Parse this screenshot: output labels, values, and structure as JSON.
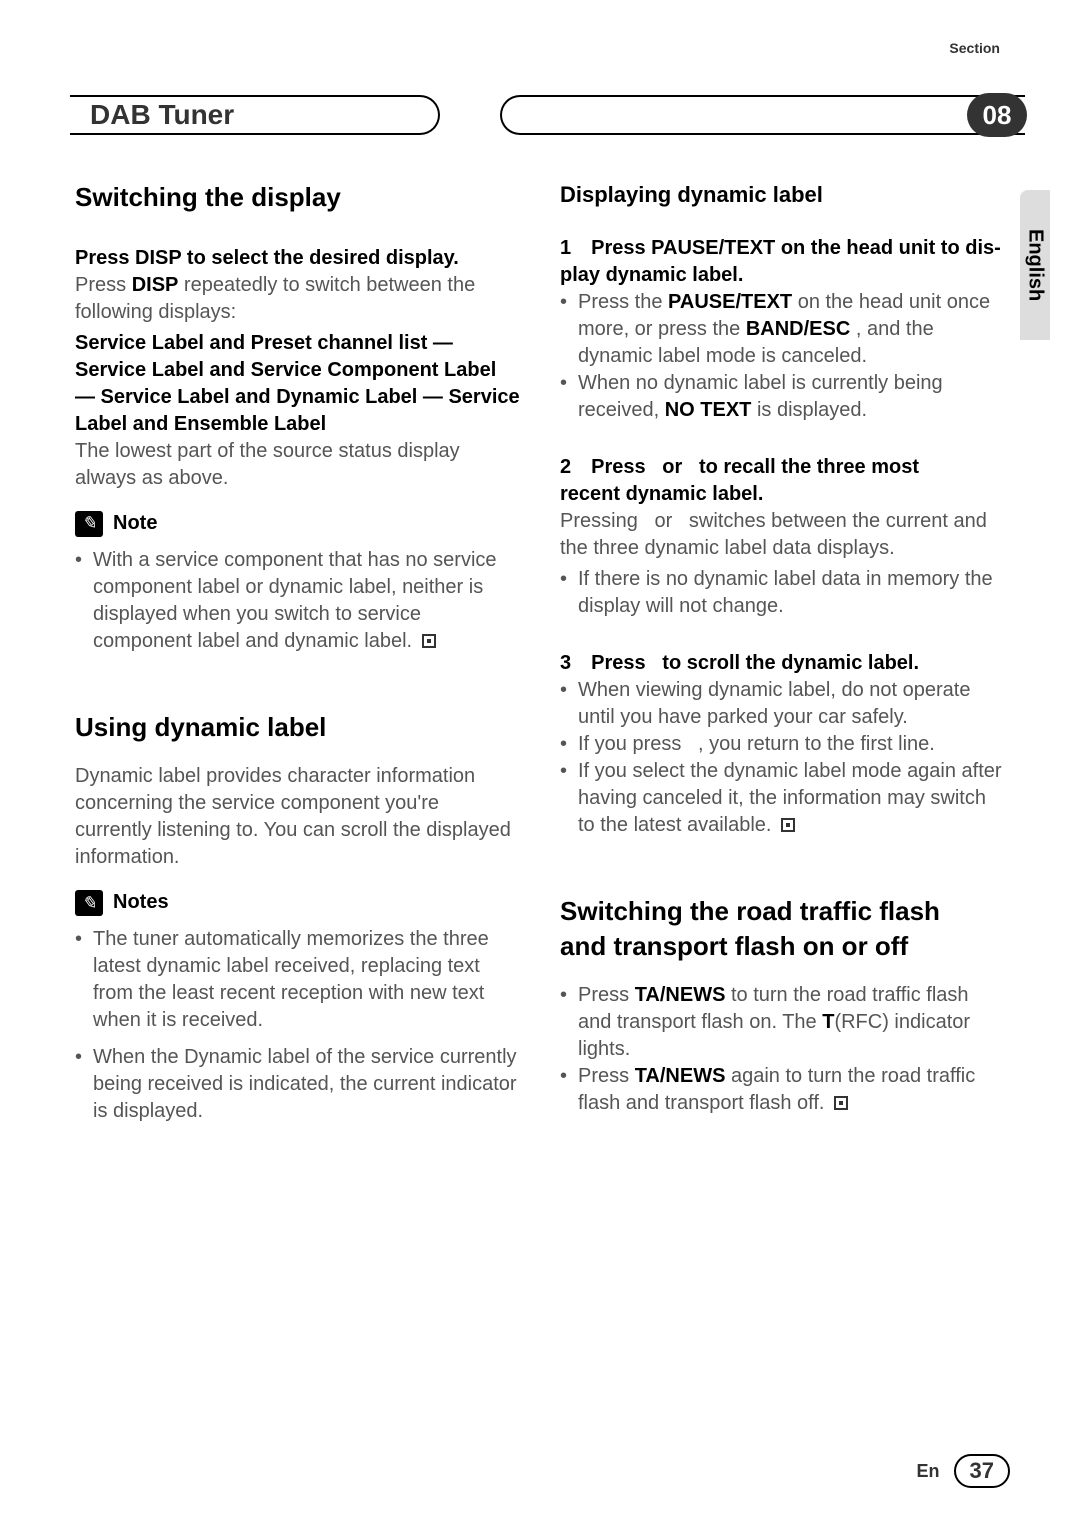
{
  "header": {
    "section_label": "Section",
    "chapter_title": "DAB Tuner",
    "chapter_number": "08"
  },
  "lang_tab": "English",
  "left": {
    "h2_switch": "Switching the display",
    "disp_bold": "Press DISP to select the desired display.",
    "disp_body_a": "Press ",
    "disp_key": "DISP",
    "disp_body_b": " repeatedly to switch between the following displays:",
    "list_bold": "Service Label and Preset channel list — Service Label and Service Component Label — Service Label and Dynamic Label — Service Label and Ensemble Label",
    "lowest": "The lowest part of the source status display always as above.",
    "note_label": "Note",
    "note_body": "With a service component that has no service component label or dynamic label, neither is displayed when you switch to service component label and dynamic label.",
    "h2_using": "Using dynamic label",
    "using_body": "Dynamic label provides character information concerning the service component you're currently listening to. You can scroll the displayed information.",
    "notes_label": "Notes",
    "notes_1": "The tuner automatically memorizes the three latest dynamic label received, replacing text from the least recent reception with new text when it is received.",
    "notes_2": "When the Dynamic label of the service currently being received is indicated, the current indicator is displayed."
  },
  "right": {
    "h3_disp_dyn": "Displaying dynamic label",
    "s1_bold_a": "1 Press PAUSE/TEXT on the head unit to dis-",
    "s1_bold_b": "play dynamic label.",
    "s1_b1_a": "Press the ",
    "s1_b1_key1": "PAUSE/TEXT",
    "s1_b1_b": " on the head unit once more, or press the ",
    "s1_b1_key2": "BAND/ESC",
    "s1_b1_c": " , and the dynamic label mode is canceled.",
    "s1_b2_a": "When no dynamic label is currently being received, ",
    "s1_b2_key": "NO TEXT",
    "s1_b2_b": " is displayed.",
    "s2_bold_a": "2 Press   or   to recall the three most",
    "s2_bold_b": "recent dynamic label.",
    "s2_body": "Pressing   or   switches between the current and the three dynamic label data displays.",
    "s2_b1": "If there is no dynamic label data in memory the display will not change.",
    "s3_bold": "3 Press   to scroll the dynamic label.",
    "s3_b1": "When viewing dynamic label, do not operate until you have parked your car safely.",
    "s3_b2": "If you press   , you return to the first line.",
    "s3_b3": "If you select the dynamic label mode again after having canceled it, the information may switch to the latest available.",
    "h2_traffic_a": "Switching the road traffic flash",
    "h2_traffic_b": "and transport flash on or off",
    "t_b1_a": "Press ",
    "t_b1_key1": "TA/NEWS",
    "t_b1_b": " to turn the road traffic flash and transport flash on. The ",
    "t_b1_key2": "T",
    "t_b1_c": "(RFC) indicator lights.",
    "t_b2_a": "Press ",
    "t_b2_key": "TA/NEWS",
    "t_b2_b": " again to turn the road traffic flash and transport flash off."
  },
  "footer": {
    "lang": "En",
    "page": "37"
  }
}
